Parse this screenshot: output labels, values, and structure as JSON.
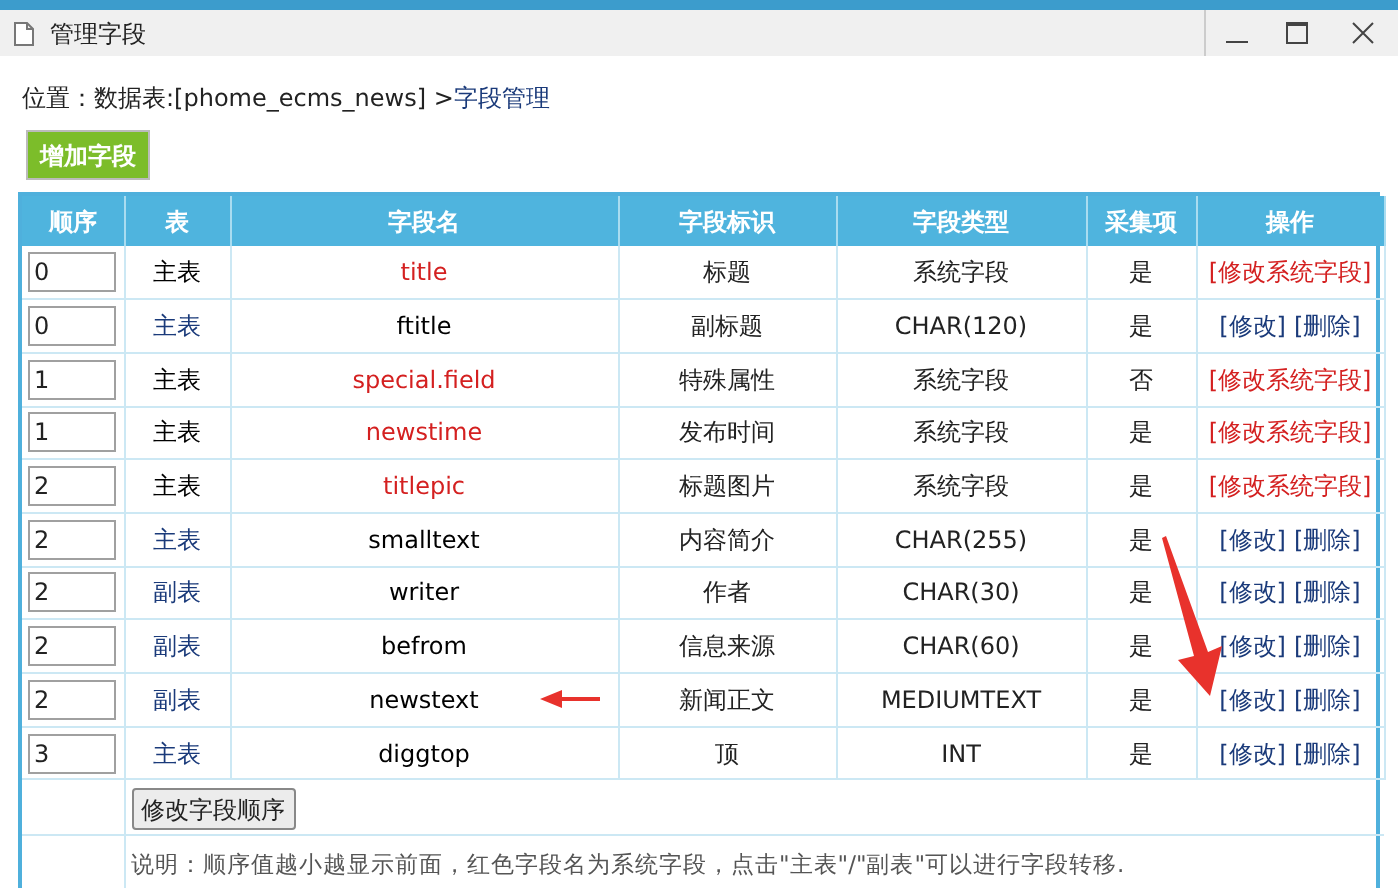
{
  "window": {
    "title": "管理字段"
  },
  "breadcrumb": {
    "label": "位置：",
    "path": "数据表:[phome_ecms_news] > ",
    "current": "字段管理"
  },
  "add_button": "增加字段",
  "table": {
    "columns": [
      "顺序",
      "表",
      "字段名",
      "字段标识",
      "字段类型",
      "采集项",
      "操作"
    ],
    "rows": [
      {
        "kind": "system",
        "order": "0",
        "table": "主表",
        "name": "title",
        "label": "标题",
        "type": "系统字段",
        "collect": "是",
        "actions": [
          "[修改系统字段]"
        ]
      },
      {
        "kind": "custom",
        "order": "0",
        "table": "主表",
        "name": "ftitle",
        "label": "副标题",
        "type": "CHAR(120)",
        "collect": "是",
        "actions": [
          "[修改]",
          "[删除]"
        ]
      },
      {
        "kind": "system",
        "order": "1",
        "table": "主表",
        "name": "special.field",
        "label": "特殊属性",
        "type": "系统字段",
        "collect": "否",
        "actions": [
          "[修改系统字段]"
        ]
      },
      {
        "kind": "system",
        "order": "1",
        "table": "主表",
        "name": "newstime",
        "label": "发布时间",
        "type": "系统字段",
        "collect": "是",
        "actions": [
          "[修改系统字段]"
        ]
      },
      {
        "kind": "system",
        "order": "2",
        "table": "主表",
        "name": "titlepic",
        "label": "标题图片",
        "type": "系统字段",
        "collect": "是",
        "actions": [
          "[修改系统字段]"
        ]
      },
      {
        "kind": "custom",
        "order": "2",
        "table": "主表",
        "name": "smalltext",
        "label": "内容简介",
        "type": "CHAR(255)",
        "collect": "是",
        "actions": [
          "[修改]",
          "[删除]"
        ]
      },
      {
        "kind": "custom",
        "order": "2",
        "table": "副表",
        "name": "writer",
        "label": "作者",
        "type": "CHAR(30)",
        "collect": "是",
        "actions": [
          "[修改]",
          "[删除]"
        ]
      },
      {
        "kind": "custom",
        "order": "2",
        "table": "副表",
        "name": "befrom",
        "label": "信息来源",
        "type": "CHAR(60)",
        "collect": "是",
        "actions": [
          "[修改]",
          "[删除]"
        ]
      },
      {
        "kind": "custom",
        "order": "2",
        "table": "副表",
        "name": "newstext",
        "label": "新闻正文",
        "type": "MEDIUMTEXT",
        "collect": "是",
        "actions": [
          "[修改]",
          "[删除]"
        ]
      },
      {
        "kind": "custom",
        "order": "3",
        "table": "主表",
        "name": "diggtop",
        "label": "顶",
        "type": "INT",
        "collect": "是",
        "actions": [
          "[修改]",
          "[删除]"
        ]
      }
    ]
  },
  "save_order_button": "修改字段顺序",
  "note": "说明：顺序值越小越显示前面，红色字段名为系统字段，点击\"主表\"/\"副表\"可以进行字段转移."
}
